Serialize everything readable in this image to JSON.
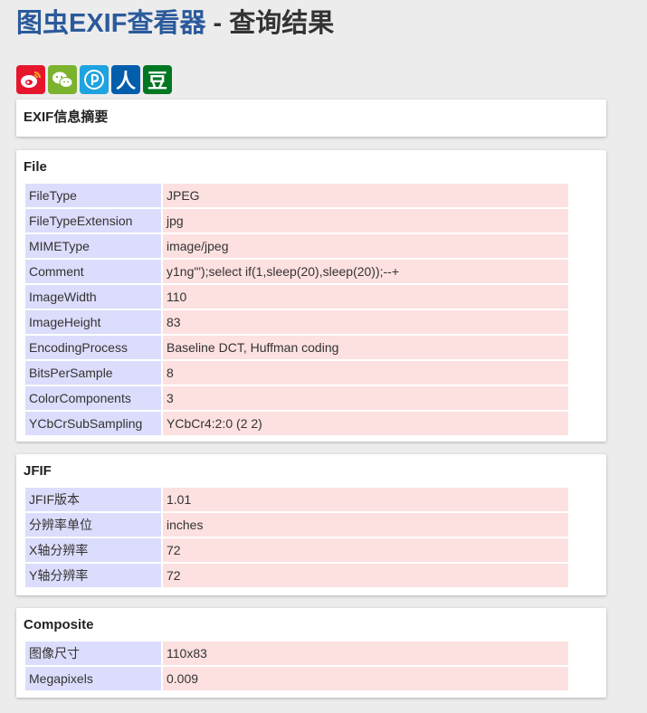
{
  "header": {
    "brand": "图虫EXIF查看器",
    "rest": " - 查询结果"
  },
  "share": {
    "icons": [
      "weibo-icon",
      "wechat-icon",
      "qq-plus-icon",
      "renren-icon",
      "douban-icon"
    ],
    "renren_glyph": "人",
    "douban_glyph": "豆"
  },
  "summary": {
    "title": "EXIF信息摘要"
  },
  "file": {
    "title": "File",
    "rows": [
      {
        "k": "FileType",
        "v": "JPEG"
      },
      {
        "k": "FileTypeExtension",
        "v": "jpg"
      },
      {
        "k": "MIMEType",
        "v": "image/jpeg"
      },
      {
        "k": "Comment",
        "v": "y1ng'\");select if(1,sleep(20),sleep(20));--+"
      },
      {
        "k": "ImageWidth",
        "v": "110"
      },
      {
        "k": "ImageHeight",
        "v": "83"
      },
      {
        "k": "EncodingProcess",
        "v": "Baseline DCT, Huffman coding"
      },
      {
        "k": "BitsPerSample",
        "v": "8"
      },
      {
        "k": "ColorComponents",
        "v": "3"
      },
      {
        "k": "YCbCrSubSampling",
        "v": "YCbCr4:2:0 (2 2)"
      }
    ]
  },
  "jfif": {
    "title": "JFIF",
    "rows": [
      {
        "k": "JFIF版本",
        "v": "1.01"
      },
      {
        "k": "分辨率单位",
        "v": "inches"
      },
      {
        "k": "X轴分辨率",
        "v": "72"
      },
      {
        "k": "Y轴分辨率",
        "v": "72"
      }
    ]
  },
  "composite": {
    "title": "Composite",
    "rows": [
      {
        "k": "图像尺寸",
        "v": "110x83"
      },
      {
        "k": "Megapixels",
        "v": "0.009"
      }
    ]
  },
  "colors": {
    "brand": "#2b5a9b",
    "key_bg": "#dcdcfc",
    "value_bg": "#fde0e0",
    "page_bg": "#ececec"
  }
}
